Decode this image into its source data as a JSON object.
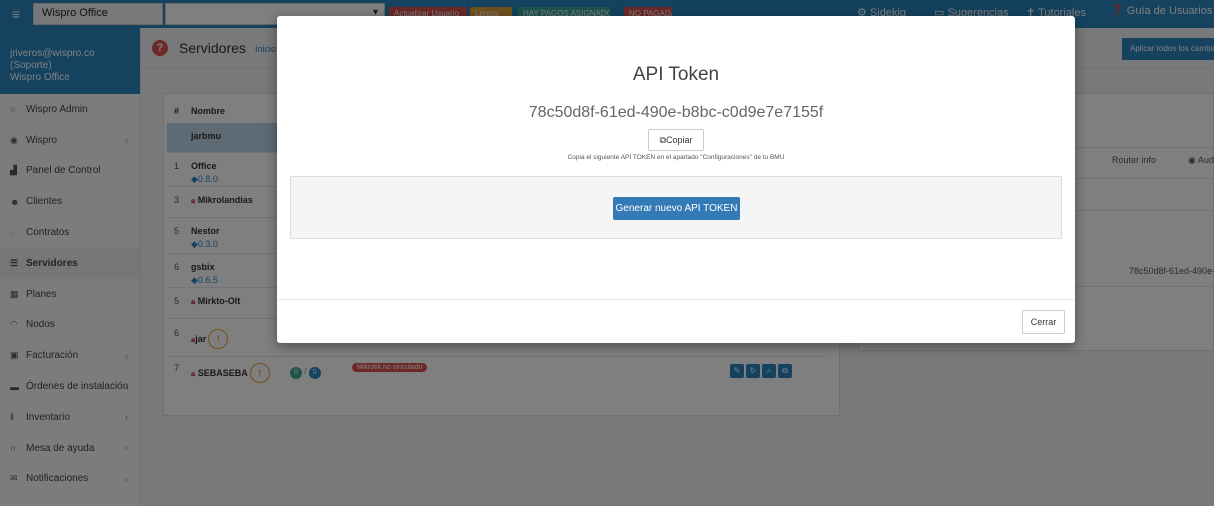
{
  "topbar": {
    "company": "Wispro Office",
    "badges": [
      "Actualizar Usuario",
      "Lentos",
      "HAY PAGOS ASIGNADOS 4000",
      "NO PAGADA"
    ],
    "links": [
      "Sidekiq",
      "Sugerencias",
      "Tutoriales",
      "Guía de Usuarios"
    ]
  },
  "sidebar": {
    "user_email": "jriveros@wispro.co (Soporte)",
    "user_company": "Wispro Office",
    "items": [
      {
        "label": "Wispro Admin",
        "icon": "circle-icon"
      },
      {
        "label": "Wispro",
        "icon": "eye-icon"
      },
      {
        "label": "Panel de Control",
        "icon": "chart-icon"
      },
      {
        "label": "Clientes",
        "icon": "users-icon"
      },
      {
        "label": "Contratos",
        "icon": "handshake-icon"
      },
      {
        "label": "Servidores",
        "icon": "list-icon"
      },
      {
        "label": "Planes",
        "icon": "grid-icon"
      },
      {
        "label": "Nodos",
        "icon": "wifi-icon"
      },
      {
        "label": "Facturación",
        "icon": "invoice-icon"
      },
      {
        "label": "Órdenes de instalación",
        "icon": "truck-icon"
      },
      {
        "label": "Inventario",
        "icon": "barcode-icon"
      },
      {
        "label": "Mesa de ayuda",
        "icon": "headset-icon"
      },
      {
        "label": "Notificaciones",
        "icon": "envelope-icon"
      }
    ]
  },
  "page": {
    "title": "Servidores",
    "breadcrumb": "Inicio",
    "apply_button": "Aplicar todos los cambios"
  },
  "table": {
    "headers": [
      "#",
      "Nombre"
    ],
    "rows": [
      {
        "num": "",
        "name": "jarbmu",
        "version": ""
      },
      {
        "num": "1",
        "name": "Office",
        "version": "0.8.0"
      },
      {
        "num": "3",
        "name": "Mikrolandias",
        "version": ""
      },
      {
        "num": "5",
        "name": "Nestor",
        "version": "0.3.0"
      },
      {
        "num": "6",
        "name": "gsbix",
        "version": "0.6.5"
      },
      {
        "num": "5",
        "name": "Mirkto-Olt",
        "version": ""
      },
      {
        "num": "6",
        "name": "jar",
        "version": ""
      },
      {
        "num": "7",
        "name": "SEBASEBA",
        "version": ""
      }
    ],
    "counts": [
      "0",
      "0"
    ],
    "status_badge": "Mikrotik no vinculado"
  },
  "right_panel": {
    "col_router": "Router info",
    "col_aud": "Aud",
    "token_preview": "78c50d8f-61ed-490e-b"
  },
  "modal": {
    "title": "API Token",
    "token": "78c50d8f-61ed-490e-b8bc-c0d9e7e7155f",
    "copy_label": "Copiar",
    "hint": "Copia el siguiente API TOKEN en el apartado \"Configuraciones\" de tu BMU",
    "generate_label": "Generar nuevo API TOKEN",
    "close_label": "Cerrar"
  },
  "colors": {
    "primary": "#2a84bd",
    "button_blue": "#337ab7",
    "danger": "#d9534f",
    "warning": "#e6a23c",
    "info": "#3aa89b"
  }
}
